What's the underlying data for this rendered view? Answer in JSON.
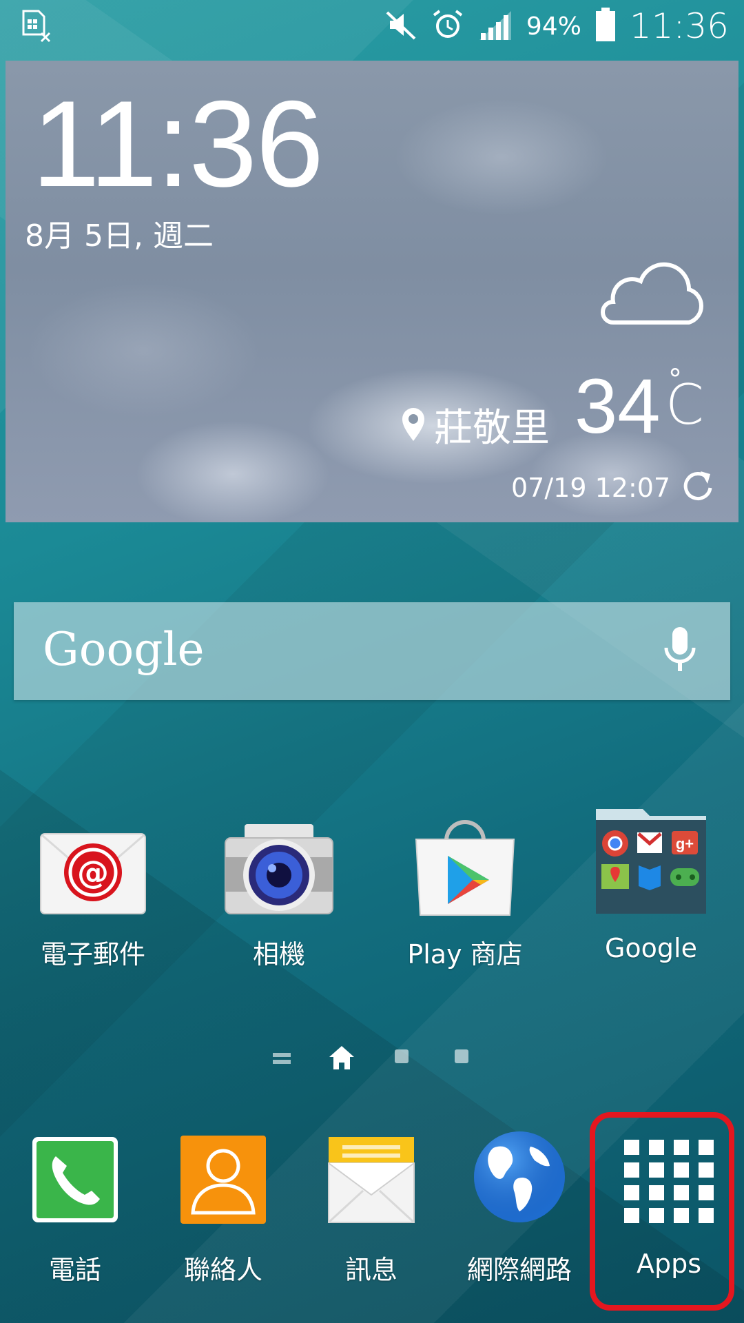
{
  "status_bar": {
    "battery": "94%",
    "time": "11:36",
    "icons": [
      "sim-card-error-icon",
      "mute-icon",
      "alarm-icon",
      "signal-icon",
      "battery-icon"
    ]
  },
  "weather_widget": {
    "time": "11:36",
    "date": "8月 5日, 週二",
    "location": "莊敬里",
    "temperature": "34",
    "unit_symbol": "°",
    "unit_letter": "C",
    "updated": "07/19 12:07",
    "condition_icon": "cloud-icon"
  },
  "search": {
    "logo": "Google",
    "mic_icon": "microphone-icon"
  },
  "apps": [
    {
      "label": "電子郵件",
      "icon": "email-icon"
    },
    {
      "label": "相機",
      "icon": "camera-icon"
    },
    {
      "label": "Play 商店",
      "icon": "play-store-icon"
    },
    {
      "label": "Google",
      "icon": "google-folder-icon"
    }
  ],
  "pages": {
    "current": 2,
    "total": 4
  },
  "dock": [
    {
      "label": "電話",
      "icon": "phone-icon"
    },
    {
      "label": "聯絡人",
      "icon": "contacts-icon"
    },
    {
      "label": "訊息",
      "icon": "messages-icon"
    },
    {
      "label": "網際網路",
      "icon": "internet-icon"
    },
    {
      "label": "Apps",
      "icon": "apps-grid-icon"
    }
  ],
  "colors": {
    "highlight": "#e4171f",
    "accent": "#1b8a96"
  }
}
